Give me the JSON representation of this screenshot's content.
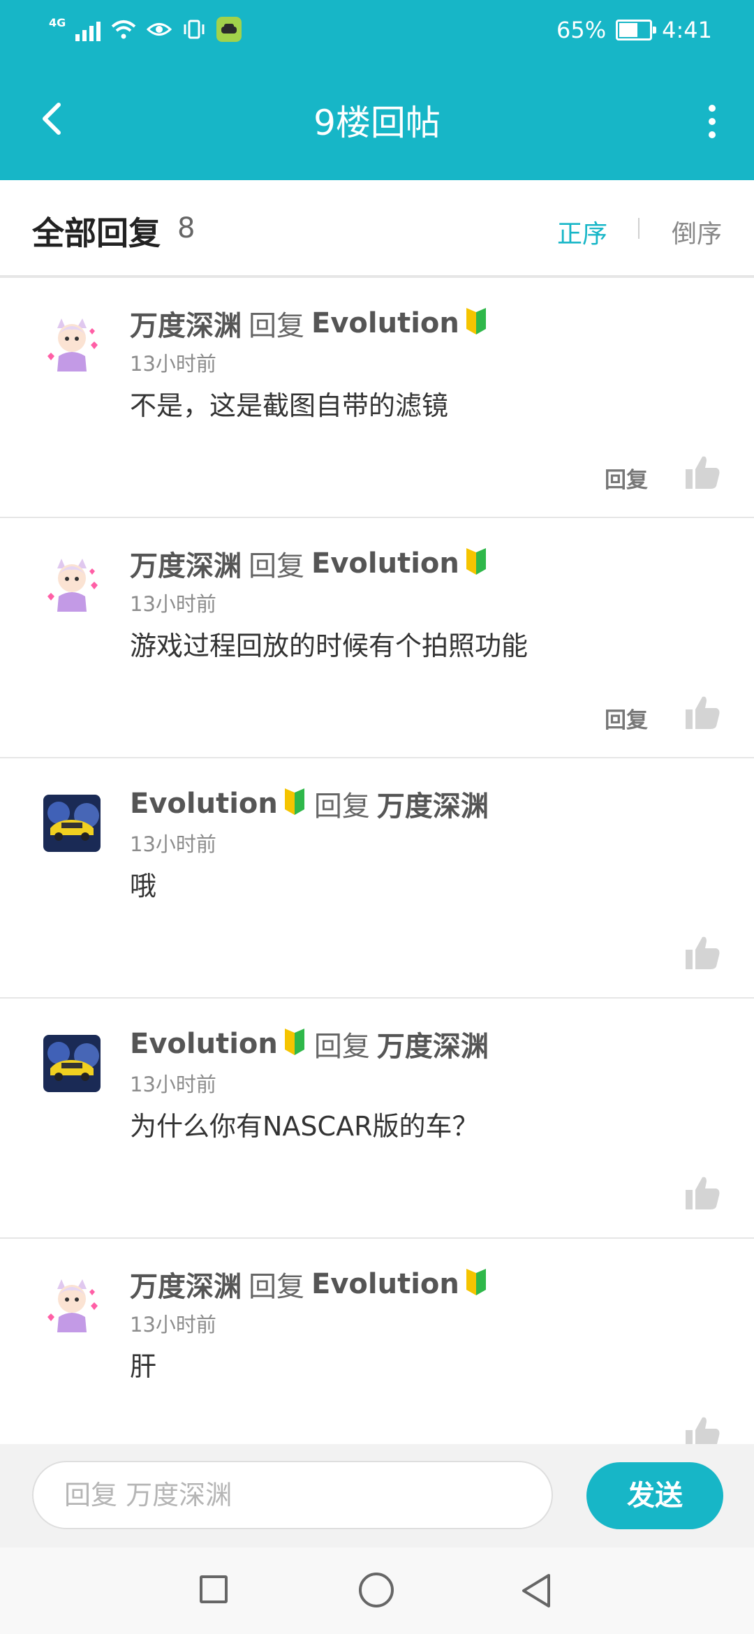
{
  "status_bar": {
    "network": "4G",
    "battery_percent": "65%",
    "battery_level": 0.65,
    "time": "4:41",
    "icons": [
      "signal-icon",
      "wifi-icon",
      "eye-icon",
      "vibrate-icon",
      "app-notification-icon",
      "battery-icon"
    ]
  },
  "header": {
    "title": "9楼回帖",
    "back_icon": "back-chevron-icon",
    "more_icon": "more-vertical-icon",
    "bg_color": "#17b6c7"
  },
  "sortbar": {
    "title": "全部回复",
    "count": "8",
    "asc_label": "正序",
    "desc_label": "倒序",
    "active": "asc",
    "accent_color": "#17b6c7"
  },
  "replies": [
    {
      "author": "万度深渊",
      "verb": "回复",
      "target": "Evolution",
      "target_badge": true,
      "author_badge": false,
      "avatar": "cartoon-girl",
      "time": "13小时前",
      "content": "不是，这是截图自带的滤镜",
      "reply_label": "回复"
    },
    {
      "author": "万度深渊",
      "verb": "回复",
      "target": "Evolution",
      "target_badge": true,
      "author_badge": false,
      "avatar": "cartoon-girl",
      "time": "13小时前",
      "content": "游戏过程回放的时候有个拍照功能",
      "reply_label": "回复"
    },
    {
      "author": "Evolution",
      "verb": "回复",
      "target": "万度深渊",
      "target_badge": false,
      "author_badge": true,
      "avatar": "yellow-car",
      "time": "13小时前",
      "content": "哦",
      "reply_label": ""
    },
    {
      "author": "Evolution",
      "verb": "回复",
      "target": "万度深渊",
      "target_badge": false,
      "author_badge": true,
      "avatar": "yellow-car",
      "time": "13小时前",
      "content": "为什么你有NASCAR版的车？",
      "reply_label": ""
    },
    {
      "author": "万度深渊",
      "verb": "回复",
      "target": "Evolution",
      "target_badge": true,
      "author_badge": false,
      "avatar": "cartoon-girl",
      "time": "13小时前",
      "content": "肝",
      "reply_label": ""
    }
  ],
  "input": {
    "placeholder": "回复 万度深渊",
    "send_label": "发送"
  },
  "system_nav": {
    "icons": [
      "recent-apps-icon",
      "home-icon",
      "back-triangle-icon"
    ]
  }
}
